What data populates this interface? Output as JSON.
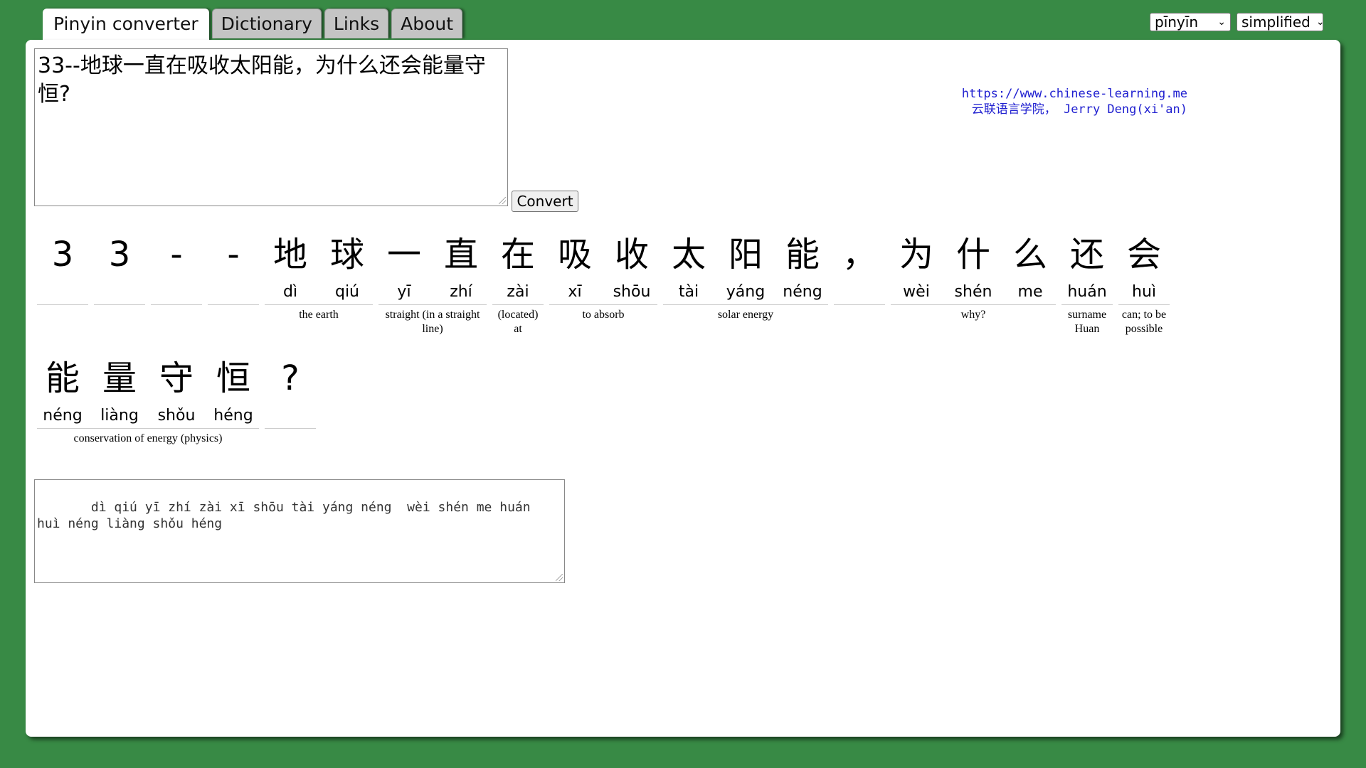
{
  "tabs": [
    "Pinyin converter",
    "Dictionary",
    "Links",
    "About"
  ],
  "selects": {
    "tone_mode": "pīnyīn",
    "script": "simplified"
  },
  "input_text": "33--地球一直在吸收太阳能，为什么还会能量守恒?",
  "convert_label": "Convert",
  "credit": {
    "url": "https://www.chinese-learning.me",
    "author": "云联语言学院， Jerry Deng(xi'an)"
  },
  "row1": [
    {
      "chars": [
        {
          "h": "3",
          "p": ""
        }
      ],
      "gloss": ""
    },
    {
      "chars": [
        {
          "h": "3",
          "p": ""
        }
      ],
      "gloss": ""
    },
    {
      "chars": [
        {
          "h": "-",
          "p": ""
        }
      ],
      "gloss": ""
    },
    {
      "chars": [
        {
          "h": "-",
          "p": ""
        }
      ],
      "gloss": ""
    },
    {
      "chars": [
        {
          "h": "地",
          "p": "dì"
        },
        {
          "h": "球",
          "p": "qiú"
        }
      ],
      "gloss": "the earth"
    },
    {
      "chars": [
        {
          "h": "一",
          "p": "yī"
        },
        {
          "h": "直",
          "p": "zhí"
        }
      ],
      "gloss": "straight (in a straight line)"
    },
    {
      "chars": [
        {
          "h": "在",
          "p": "zài"
        }
      ],
      "gloss": "(located) at"
    },
    {
      "chars": [
        {
          "h": "吸",
          "p": "xī"
        },
        {
          "h": "收",
          "p": "shōu"
        }
      ],
      "gloss": "to absorb"
    },
    {
      "chars": [
        {
          "h": "太",
          "p": "tài"
        },
        {
          "h": "阳",
          "p": "yáng"
        },
        {
          "h": "能",
          "p": "néng"
        }
      ],
      "gloss": "solar energy"
    },
    {
      "chars": [
        {
          "h": "，",
          "p": ""
        }
      ],
      "gloss": ""
    },
    {
      "chars": [
        {
          "h": "为",
          "p": "wèi"
        },
        {
          "h": "什",
          "p": "shén"
        },
        {
          "h": "么",
          "p": "me"
        }
      ],
      "gloss": "why?"
    },
    {
      "chars": [
        {
          "h": "还",
          "p": "huán"
        }
      ],
      "gloss": "surname Huan"
    },
    {
      "chars": [
        {
          "h": "会",
          "p": "huì"
        }
      ],
      "gloss": "can; to be possible"
    }
  ],
  "row2": [
    {
      "chars": [
        {
          "h": "能",
          "p": "néng"
        },
        {
          "h": "量",
          "p": "liàng"
        },
        {
          "h": "守",
          "p": "shǒu"
        },
        {
          "h": "恒",
          "p": "héng"
        }
      ],
      "gloss": "conservation of energy (physics)"
    },
    {
      "chars": [
        {
          "h": "?",
          "p": ""
        }
      ],
      "gloss": ""
    }
  ],
  "output_text": "   dì qiú yī zhí zài xī shōu tài yáng néng  wèi shén me huán\nhuì néng liàng shǒu héng"
}
